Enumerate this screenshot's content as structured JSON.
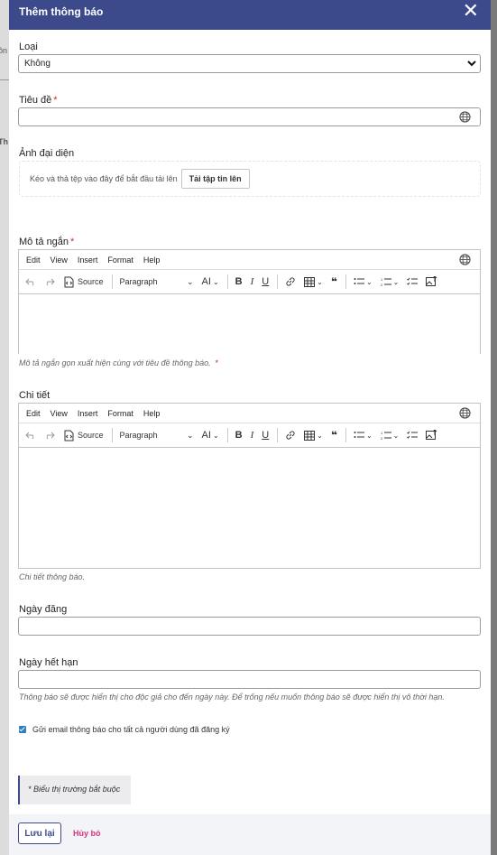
{
  "modal": {
    "title": "Thêm thông báo",
    "close_icon": "close-icon"
  },
  "type_field": {
    "label": "Loại",
    "value": "Không"
  },
  "title_field": {
    "label": "Tiêu đề",
    "required_mark": "*",
    "value": ""
  },
  "image_field": {
    "label": "Ảnh đại diện",
    "dropzone_text": "Kéo và thả tệp vào đây để bắt đầu tải lên",
    "upload_button": "Tải tập tin lên"
  },
  "short_desc": {
    "label": "Mô tả ngắn",
    "required_mark": "*",
    "helper": "Mô tả ngắn gọn xuất hiện cùng với tiêu đề thông báo.",
    "helper_mark": "*"
  },
  "detail": {
    "label": "Chi tiết",
    "helper": "Chi tiết thông báo."
  },
  "editor": {
    "menu": [
      "Edit",
      "View",
      "Insert",
      "Format",
      "Help"
    ],
    "source_label": "Source",
    "paragraph_label": "Paragraph"
  },
  "publish_date": {
    "label": "Ngày đăng",
    "value": ""
  },
  "expiry_date": {
    "label": "Ngày hết hạn",
    "value": "",
    "helper": "Thông báo sẽ được hiển thị cho độc giả cho đến ngày này. Để trống nếu muốn thông báo sẽ được hiển thị vô thời hạn."
  },
  "email_option": {
    "label": "Gửi email thông báo cho tất cả người dùng đã đăng ký",
    "checked": true
  },
  "required_note": "* Biểu thị trường bắt buộc",
  "footer": {
    "save": "Lưu lại",
    "cancel": "Hủy bỏ"
  },
  "colors": {
    "header": "#3c4a8c",
    "required": "#d9262e",
    "cancel": "#d8337d",
    "checkbox": "#2d7fc1"
  }
}
